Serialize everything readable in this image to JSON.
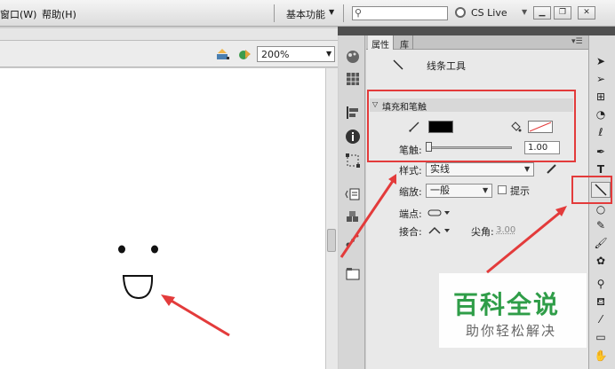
{
  "menubar": {
    "window_menu": "窗口(W)",
    "help_menu": "帮助(H)",
    "workspace": "基本功能",
    "search_placeholder": "",
    "cs_live": "CS Live"
  },
  "stage": {
    "zoom": "200%"
  },
  "panel": {
    "tab_properties": "属性",
    "tab_library": "库",
    "tool_name": "线条工具",
    "section_fill_stroke": "填充和笔触",
    "stroke_label": "笔触:",
    "stroke_value": "1.00",
    "style_label": "样式:",
    "style_value": "实线",
    "scale_label": "缩放:",
    "scale_value": "一般",
    "hint_label": "提示",
    "cap_label": "端点:",
    "join_label": "接合:",
    "miter_label": "尖角:",
    "miter_value": "3.00"
  },
  "watermark": {
    "title": "百科全说",
    "subtitle": "助你轻松解决"
  },
  "colors": {
    "stroke_color": "#000000",
    "annotation_red": "#e33b3b",
    "watermark_green": "#2f9d48"
  },
  "icons": [
    "search-icon",
    "cs-live-icon",
    "minimize-icon",
    "restore-icon",
    "close-icon",
    "edit-scene-icon",
    "edit-symbol-icon",
    "line-tool-icon",
    "pencil-icon",
    "paint-bucket-icon",
    "selection-icon",
    "subselection-icon",
    "free-transform-icon",
    "3d-rotation-icon",
    "lasso-icon",
    "pen-icon",
    "text-icon",
    "rectangle-icon",
    "brush-icon",
    "deco-icon",
    "bone-icon",
    "ink-bottle-icon",
    "eyedropper-icon",
    "eraser-icon",
    "hand-icon"
  ]
}
